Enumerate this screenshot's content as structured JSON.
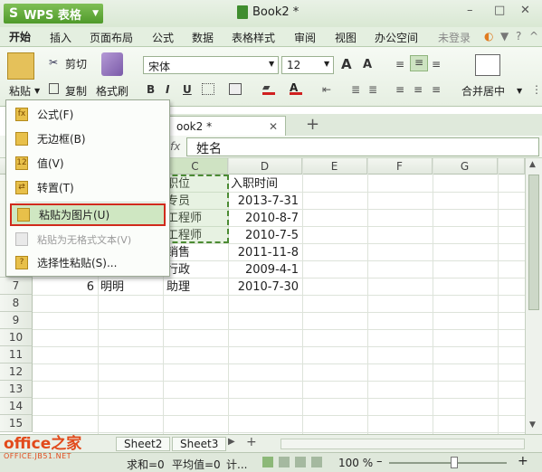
{
  "app": {
    "name": "WPS 表格",
    "logo": "S",
    "doc_title": "Book2 *"
  },
  "window": {
    "min": "–",
    "max": "□",
    "close": "✕"
  },
  "menubar": [
    "开始",
    "插入",
    "页面布局",
    "公式",
    "数据",
    "表格样式",
    "审阅",
    "视图",
    "办公空间"
  ],
  "account": {
    "login": "未登录"
  },
  "ribbon": {
    "paste": "粘贴",
    "cut": "剪切",
    "copy": "复制",
    "format_painter": "格式刷",
    "font": "宋体",
    "size": "12",
    "grow": "A",
    "shrink": "A",
    "bold": "B",
    "italic": "I",
    "underline": "U",
    "merge": "合并居中"
  },
  "doc_tab": {
    "label": "ook2 *",
    "add": "+"
  },
  "formula": {
    "fx": "fx",
    "value": "姓名"
  },
  "columns": [
    "C",
    "D",
    "E",
    "F",
    "G"
  ],
  "rows": [
    "7",
    "8",
    "9",
    "10",
    "11",
    "12",
    "13",
    "14",
    "15"
  ],
  "cells": {
    "c2": "职位",
    "d2": "入职时间",
    "c3": "专员",
    "d3": "2013-7-31",
    "c4": "工程师",
    "d4": "2010-8-7",
    "c5": "工程师",
    "d5": "2010-7-5",
    "c6": "销售",
    "d6": "2011-11-8",
    "c7": "行政",
    "d7": "2009-4-1",
    "a8": "6",
    "b8": "明明",
    "c8": "助理",
    "d8": "2010-7-30"
  },
  "paste_menu": [
    {
      "label": "公式(F)",
      "icon": "formula-icon",
      "disabled": false,
      "highlight": false
    },
    {
      "label": "无边框(B)",
      "icon": "no-border-icon",
      "disabled": false,
      "highlight": false
    },
    {
      "label": "值(V)",
      "icon": "values-icon",
      "disabled": false,
      "highlight": false
    },
    {
      "label": "转置(T)",
      "icon": "transpose-icon",
      "disabled": false,
      "highlight": false
    },
    {
      "label": "粘贴为图片(U)",
      "icon": "paste-picture-icon",
      "disabled": false,
      "highlight": true
    },
    {
      "label": "粘贴为无格式文本(V)",
      "icon": "paste-text-icon",
      "disabled": true,
      "highlight": false
    },
    {
      "label": "选择性粘贴(S)...",
      "icon": "paste-special-icon",
      "disabled": false,
      "highlight": false
    }
  ],
  "sheets": [
    "Sheet2",
    "Sheet3"
  ],
  "sheet_add": "+",
  "status": {
    "sum": "求和=0",
    "avg": "平均值=0",
    "more": "计...",
    "zoom": "100 %"
  },
  "watermark": {
    "logo": "office之家",
    "url": "OFFICE.JB51.NET"
  },
  "colors": {
    "accent": "#4f9a2a",
    "highlight_border": "#d02a1c",
    "selection": "#4b8b33"
  }
}
